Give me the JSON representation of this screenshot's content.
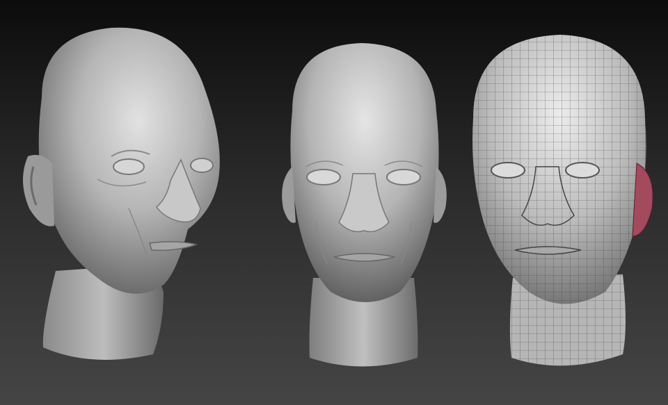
{
  "scene": {
    "background_top": "#0c0c0c",
    "background_bottom": "#454545",
    "clay_color": "#b9b9b9",
    "clay_shadow": "#5e5e5e",
    "ear_highlight": "#a34a5c",
    "models": [
      {
        "view": "three-quarter",
        "wireframe": false
      },
      {
        "view": "front",
        "wireframe": false
      },
      {
        "view": "front",
        "wireframe": true
      }
    ]
  }
}
